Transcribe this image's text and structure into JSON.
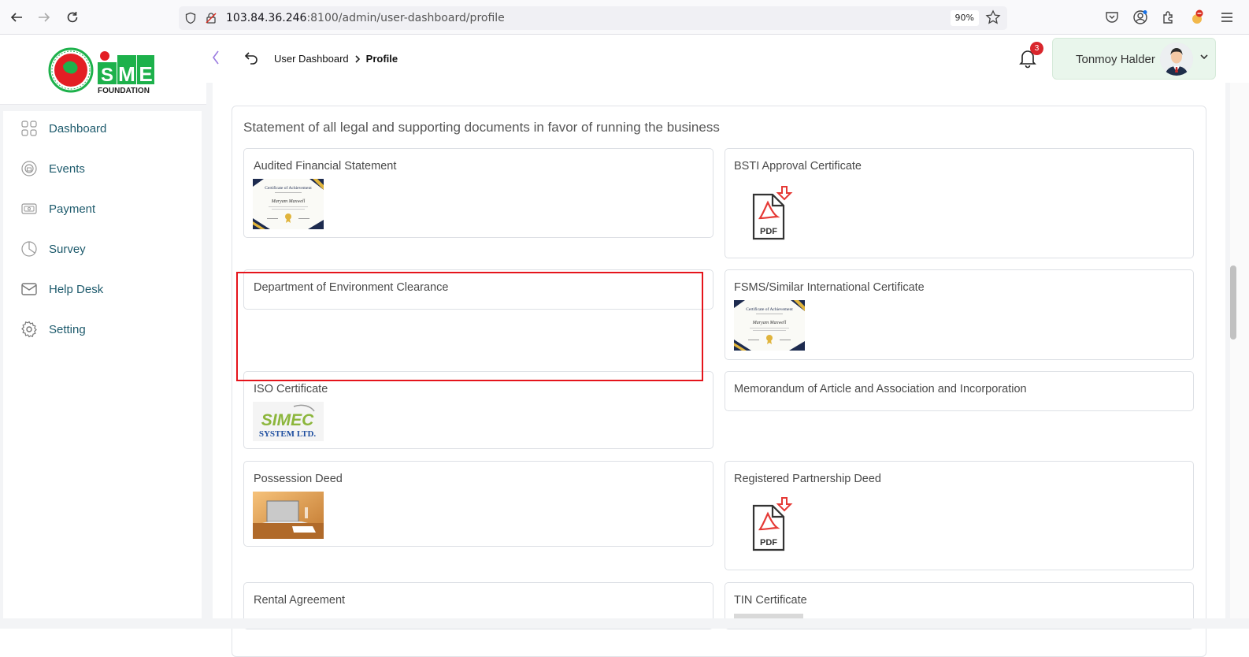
{
  "browser": {
    "url_host": "103.84.36.246",
    "url_rest": ":8100/admin/user-dashboard/profile",
    "zoom": "90%"
  },
  "brand": {
    "name_line1": "SME",
    "name_line2": "FOUNDATION",
    "accent_green": "#1db14b",
    "accent_red": "#e31e24"
  },
  "sidebar": {
    "items": [
      {
        "label": "Dashboard",
        "icon": "grid-icon"
      },
      {
        "label": "Events",
        "icon": "events-icon"
      },
      {
        "label": "Payment",
        "icon": "payment-icon"
      },
      {
        "label": "Survey",
        "icon": "pie-chart-icon"
      },
      {
        "label": "Help Desk",
        "icon": "mail-icon"
      },
      {
        "label": "Setting",
        "icon": "gear-icon"
      }
    ]
  },
  "header": {
    "breadcrumb_parent": "User Dashboard",
    "breadcrumb_current": "Profile",
    "notification_count": "3",
    "user_name": "Tonmoy Halder"
  },
  "section": {
    "title": "Statement of all legal and supporting documents in favor of running the business",
    "documents": [
      {
        "title": "Audited Financial Statement",
        "thumb": "certificate"
      },
      {
        "title": "BSTI Approval Certificate",
        "thumb": "pdf"
      },
      {
        "title": "Department of Environment Clearance",
        "thumb": "none"
      },
      {
        "title": "FSMS/Similar International Certificate",
        "thumb": "certificate"
      },
      {
        "title": "ISO Certificate",
        "thumb": "simec-logo"
      },
      {
        "title": "Memorandum of Article and Association and Incorporation",
        "thumb": "none"
      },
      {
        "title": "Possession Deed",
        "thumb": "photo"
      },
      {
        "title": "Registered Partnership Deed",
        "thumb": "pdf"
      },
      {
        "title": "Rental Agreement",
        "thumb": "unknown"
      },
      {
        "title": "TIN Certificate",
        "thumb": "unknown"
      }
    ],
    "certificate_heading": "Certificate of Achievement",
    "certificate_name": "Maryam Maxwell",
    "simec_line1": "SIMEC",
    "simec_line2": "SYSTEM LTD.",
    "pdf_label": "PDF"
  }
}
